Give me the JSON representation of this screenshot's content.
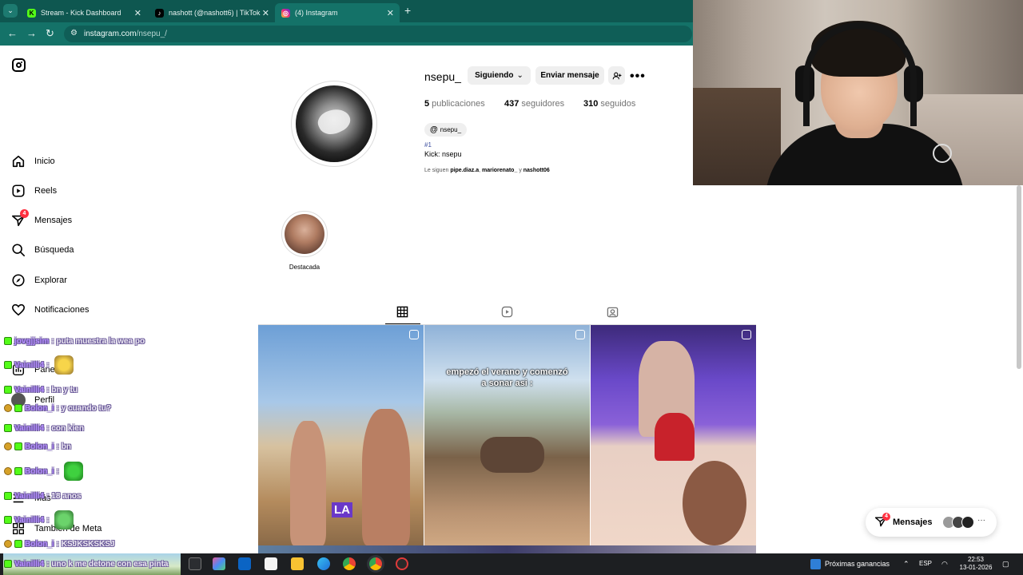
{
  "browser": {
    "tabs": [
      {
        "title": "Stream - Kick Dashboard",
        "favicon": "kick-icon",
        "active": false
      },
      {
        "title": "nashott (@nashott6) | TikTok",
        "favicon": "tiktok-icon",
        "active": false
      },
      {
        "title": "(4) Instagram",
        "favicon": "instagram-icon",
        "active": true
      }
    ],
    "url_host": "instagram.com",
    "url_path": "/nsepu_/",
    "accent": "#0e5750"
  },
  "nav": {
    "items": [
      {
        "label": "Inicio",
        "icon": "home-icon"
      },
      {
        "label": "Reels",
        "icon": "reels-icon"
      },
      {
        "label": "Mensajes",
        "icon": "messages-icon",
        "badge": "4"
      },
      {
        "label": "Búsqueda",
        "icon": "search-icon"
      },
      {
        "label": "Explorar",
        "icon": "explore-icon"
      },
      {
        "label": "Notificaciones",
        "icon": "heart-icon"
      },
      {
        "label": "Panel",
        "icon": "dashboard-icon"
      },
      {
        "label": "Perfil",
        "icon": "profile-icon"
      },
      {
        "label": "Más",
        "icon": "menu-icon"
      },
      {
        "label": "También de Meta",
        "icon": "meta-grid-icon"
      }
    ]
  },
  "profile": {
    "username": "nsepu_",
    "following_btn": "Siguiendo",
    "message_btn": "Enviar mensaje",
    "posts_count": "5",
    "posts_label": "publicaciones",
    "followers_count": "437",
    "followers_label": "seguidores",
    "following_count": "310",
    "following_label": "seguidos",
    "threads_handle": "nsepu_",
    "bio_tag": "#1",
    "bio": "Kick: nsepu",
    "followed_prefix": "Le siguen",
    "followed_by_1": "pipe.diaz.a",
    "followed_by_2": "mariorenato_",
    "followed_join": "y",
    "followed_by_3": "nashott06",
    "highlight_label": "Destacada"
  },
  "posts": [
    {
      "caption": "",
      "overlay_text": "LA"
    },
    {
      "caption_line1": "empezó el verano y comenzó",
      "caption_line2": "a sonar asi :"
    },
    {
      "caption": ""
    }
  ],
  "messages_pill": {
    "label": "Mensajes",
    "badge": "4",
    "more": "···"
  },
  "chat": [
    {
      "user": "jovgjjsim",
      "text": ": puta muestra la wea po",
      "badges": [
        "green"
      ]
    },
    {
      "user": "Vainilli4",
      "text": ":",
      "badges": [
        "green"
      ],
      "emote": "pikachu"
    },
    {
      "user": "Vainilli4",
      "text": ": bn y tu",
      "badges": [
        "green"
      ]
    },
    {
      "user": "Bolon_i",
      "text": ": y cuando tu?",
      "badges": [
        "gold",
        "green"
      ]
    },
    {
      "user": "Vainilli4",
      "text": ": con kien",
      "badges": [
        "green"
      ]
    },
    {
      "user": "Bolon_i",
      "text": ": bn",
      "badges": [
        "gold",
        "green"
      ]
    },
    {
      "user": "Bolon_i",
      "text": ":",
      "badges": [
        "gold",
        "green"
      ],
      "emote": "green-blob"
    },
    {
      "user": "Vainilli4",
      "text": ": 18 anos",
      "badges": [
        "green"
      ]
    },
    {
      "user": "Vainilli4",
      "text": ":",
      "badges": [
        "green"
      ],
      "emote": "green-face"
    },
    {
      "user": "Bolon_i",
      "text": ": KSJKSKSKSJ",
      "badges": [
        "gold",
        "green"
      ]
    },
    {
      "user": "Vainilli4",
      "text": ": uno k me detone con esa pinta",
      "badges": [
        "green"
      ]
    }
  ],
  "taskbar": {
    "news": "Próximas ganancias",
    "lang": "ESP",
    "time": "22:53",
    "date": "13-01-2026"
  }
}
